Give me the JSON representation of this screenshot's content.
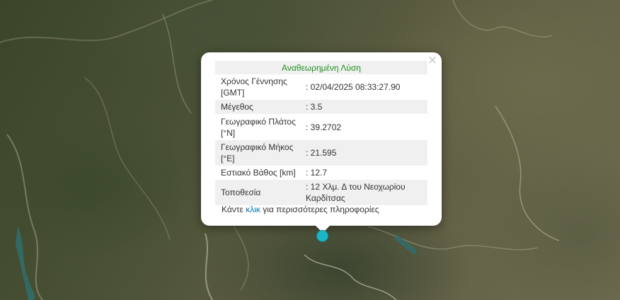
{
  "popup": {
    "title": "Αναθεωρημένη Λύση",
    "close_glyph": "×",
    "rows": [
      {
        "label": "Χρόνος Γέννησης [GMT]",
        "value": ": 02/04/2025 08:33:27.90"
      },
      {
        "label": "Μέγεθος",
        "value": ": 3.5"
      },
      {
        "label": "Γεωγραφικό Πλάτος [°N]",
        "value": ": 39.2702"
      },
      {
        "label": "Γεωγραφικό Μήκος [°E]",
        "value": ": 21.595"
      },
      {
        "label": "Εστιακό Βάθος [km]",
        "value": ": 12.7"
      },
      {
        "label": "Τοποθεσία",
        "value": ": 12 Χλμ. Δ του Νεοχωρίου Καρδίτσας"
      }
    ],
    "more_prefix": "Κάντε ",
    "more_link": "κλικ",
    "more_suffix": " για περισσότερες πληροφορίες"
  },
  "colors": {
    "title_green": "#1e8f1e",
    "link_blue": "#0078a8",
    "marker": "#1cb5c5"
  },
  "marker": {
    "icon": "epicenter-marker-icon"
  }
}
